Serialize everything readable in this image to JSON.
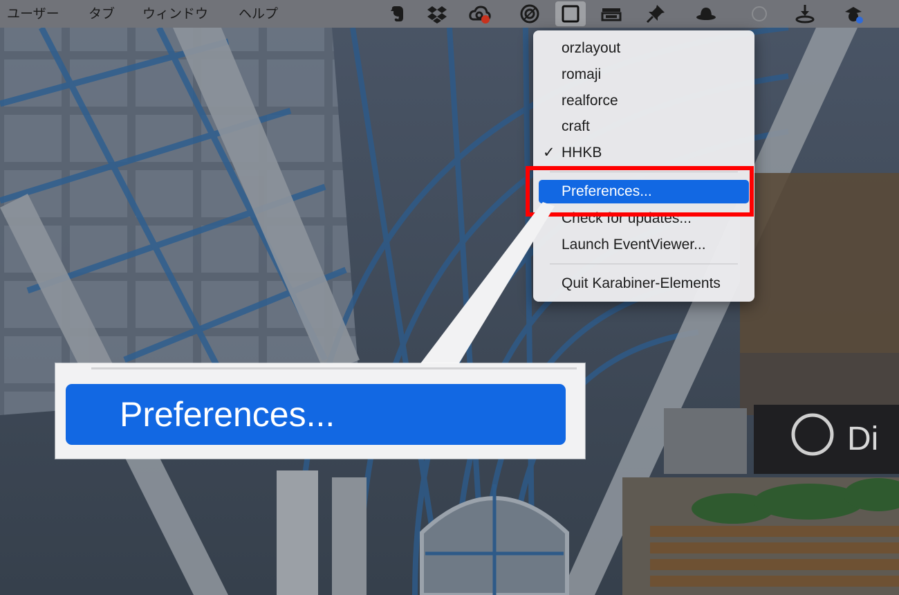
{
  "menubar": {
    "menus": [
      "ユーザー",
      "タブ",
      "ウィンドウ",
      "ヘルプ"
    ],
    "status_icons": [
      "evernote-icon",
      "dropbox-icon",
      "creative-cloud-icon",
      "target-icon",
      "karabiner-icon",
      "window-manager-icon",
      "pin-icon",
      "hat-icon",
      "blank-icon",
      "download-tray-icon",
      "account-icon"
    ]
  },
  "dropdown": {
    "items": [
      {
        "label": "orzlayout",
        "checked": false
      },
      {
        "label": "romaji",
        "checked": false
      },
      {
        "label": "realforce",
        "checked": false
      },
      {
        "label": "craft",
        "checked": false
      },
      {
        "label": "HHKB",
        "checked": true
      }
    ],
    "checkmark": "✓",
    "preferences": "Preferences...",
    "check_updates": "Check for updates...",
    "launch_eventviewer": "Launch EventViewer...",
    "quit": "Quit Karabiner-Elements"
  },
  "callout": {
    "zoomed_label": "Preferences..."
  },
  "colors": {
    "highlight": "#1268e3",
    "annotation_red": "#ff0000"
  }
}
